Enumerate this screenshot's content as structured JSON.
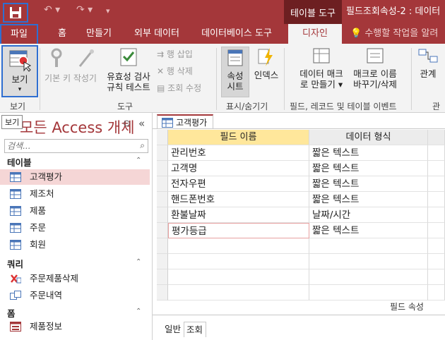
{
  "colors": {
    "accent": "#a4373a",
    "highlight": "#2f6fd1",
    "selected_row": "#f5d6d6",
    "field_header": "#ffe79b"
  },
  "titlebar": {
    "context_tool": "테이블 도구",
    "title": "필드조회속성-2 : 데이터",
    "qat_save_icon": "save-icon",
    "qat_undo_icon": "undo-icon",
    "qat_redo_icon": "redo-icon"
  },
  "tabs": {
    "file": "파일",
    "home": "홈",
    "create": "만들기",
    "external": "외부 데이터",
    "dbtools": "데이터베이스 도구",
    "design": "디자인",
    "tell_me": "수행할 작업을 알려"
  },
  "ribbon": {
    "view": {
      "label": "보기",
      "arrow": "▾",
      "group": "보기"
    },
    "tools": {
      "primary_key": "기본 키",
      "builder": "작성기",
      "test_validation": "유효성 검사\n규칙 테스트",
      "insert_rows": "행 삽입",
      "delete_rows": "행 삭제",
      "modify_lookups": "조회 수정",
      "group": "도구"
    },
    "showhide": {
      "property_sheet": "속성\n시트",
      "indexes": "인덱스",
      "group": "표시/숨기기"
    },
    "events": {
      "data_macros": "데이터 매크\n로 만들기 ▾",
      "rename_macro": "매크로 이름\n바꾸기/삭제",
      "group": "필드, 레코드 및 테이블 이벤트"
    },
    "relationships": {
      "label": "관계",
      "group_partial": "관"
    }
  },
  "navpane": {
    "tooltip": "보기",
    "title": "모든 Access 개체",
    "search_placeholder": "검색...",
    "groups": [
      {
        "label": "테이블",
        "items": [
          "고객평가",
          "제조처",
          "제품",
          "주문",
          "회원"
        ]
      },
      {
        "label": "쿼리",
        "items": [
          "주문제품삭제",
          "주문내역"
        ]
      },
      {
        "label": "폼",
        "items": [
          "제품정보"
        ]
      }
    ]
  },
  "document": {
    "tab": "고객평가",
    "headers": [
      "필드 이름",
      "데이터 형식"
    ],
    "rows": [
      [
        "관리번호",
        "짧은 텍스트"
      ],
      [
        "고객명",
        "짧은 텍스트"
      ],
      [
        "전자우편",
        "짧은 텍스트"
      ],
      [
        "핸드폰번호",
        "짧은 텍스트"
      ],
      [
        "환불날짜",
        "날짜/시간"
      ],
      [
        "평가등급",
        "짧은 텍스트"
      ]
    ],
    "field_props": "필드 속성",
    "prop_tabs": [
      "일반",
      "조회"
    ]
  }
}
